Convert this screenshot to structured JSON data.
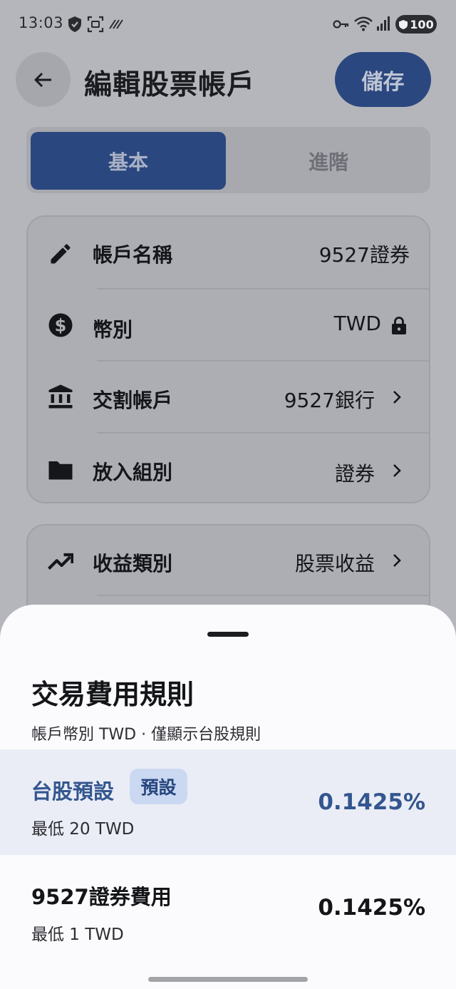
{
  "status_bar": {
    "time": "13:03",
    "battery": "100",
    "icons": [
      "shield-icon",
      "screenshot-icon",
      "no-signal-icon",
      "key-icon",
      "wifi-icon",
      "cell-signal-icon",
      "battery-icon"
    ]
  },
  "app_bar": {
    "title": "編輯股票帳戶",
    "save_label": "儲存",
    "back_icon": "arrow-left-icon"
  },
  "tabs": [
    {
      "label": "基本",
      "selected": true
    },
    {
      "label": "進階",
      "selected": false
    }
  ],
  "card1": {
    "rows": [
      {
        "icon": "pencil-icon",
        "label": "帳戶名稱",
        "value": "9527證券",
        "trailing": "none"
      },
      {
        "icon": "dollar-icon",
        "label": "幣別",
        "value": "TWD",
        "trailing": "lock-icon"
      },
      {
        "icon": "bank-icon",
        "label": "交割帳戶",
        "value": "9527銀行",
        "trailing": "chevron-right-icon"
      },
      {
        "icon": "folder-icon",
        "label": "放入組別",
        "value": "證券",
        "trailing": "chevron-right-icon"
      }
    ]
  },
  "card2": {
    "rows": [
      {
        "icon": "trending-up-icon",
        "label": "收益類別",
        "value": "股票收益",
        "trailing": "chevron-right-icon"
      }
    ]
  },
  "sheet": {
    "title": "交易費用規則",
    "subtitle": "帳戶幣別 TWD · 僅顯示台股規則",
    "rules": [
      {
        "name": "台股預設",
        "badge": "預設",
        "min": "最低 20 TWD",
        "rate": "0.1425%",
        "selected": true
      },
      {
        "name": "9527證券費用",
        "badge": "",
        "min": "最低 1 TWD",
        "rate": "0.1425%",
        "selected": false
      }
    ]
  },
  "colors": {
    "scrim_background": "#b5b6bb",
    "primary": "#2a477f",
    "selected_rule_bg": "#ebedf6",
    "selected_rule_text": "#33568f",
    "badge_bg": "#cbd8f1"
  }
}
